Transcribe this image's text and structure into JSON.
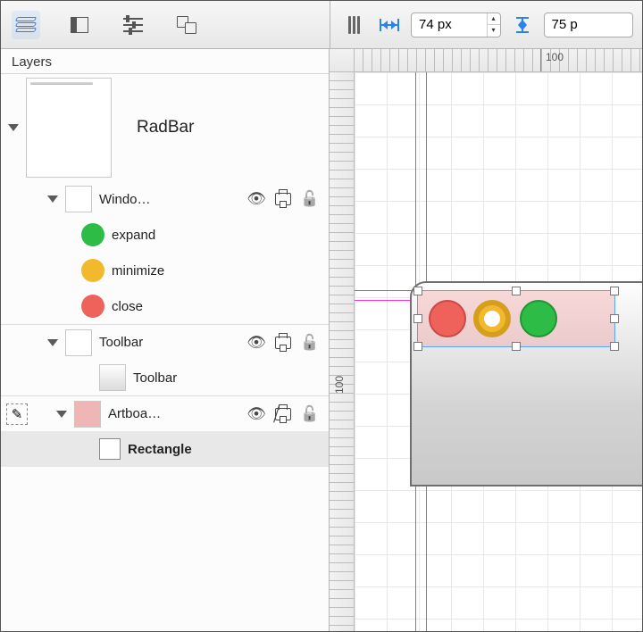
{
  "toolbar": {
    "width_value": "74 px",
    "height_value": "75 p"
  },
  "sidebar": {
    "title": "Layers",
    "artboard": {
      "name": "RadBar"
    },
    "groups": [
      {
        "name": "Windo…",
        "children": [
          {
            "name": "expand",
            "color": "green"
          },
          {
            "name": "minimize",
            "color": "yellow"
          },
          {
            "name": "close",
            "color": "red"
          }
        ]
      },
      {
        "name": "Toolbar",
        "children": [
          {
            "name": "Toolbar"
          }
        ]
      },
      {
        "name": "Artboa…",
        "children": [
          {
            "name": "Rectangle",
            "selected": true
          }
        ]
      }
    ]
  },
  "ruler": {
    "h_tick": "100",
    "v_tick": "100"
  }
}
